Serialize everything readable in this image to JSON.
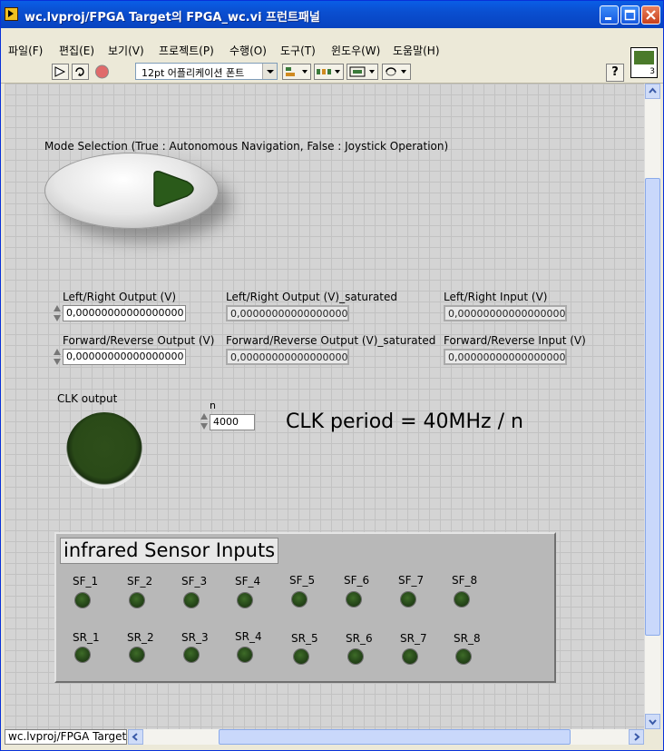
{
  "window": {
    "title": "wc.lvproj/FPGA Target의 FPGA_wc.vi 프런트패널",
    "menu": [
      "파일(F)",
      "편집(E)",
      "보기(V)",
      "프로젝트(P)",
      "수행(O)",
      "도구(T)",
      "윈도우(W)",
      "도움말(H)"
    ],
    "font_select": "12pt 어플리케이션 폰트",
    "help_label": "?",
    "vi_icon_number": "3",
    "status_field": "wc.lvproj/FPGA Target"
  },
  "panel": {
    "mode_label": "Mode Selection (True : Autonomous Navigation, False : Joystick Operation)",
    "mode_value": true,
    "lr_output_label": "Left/Right Output (V)",
    "lr_output_value": "0,00000000000000000",
    "lr_output_sat_label": "Left/Right Output (V)_saturated",
    "lr_output_sat_value": "0,00000000000000000",
    "lr_input_label": "Left/Right Input (V)",
    "lr_input_value": "0,00000000000000000",
    "fr_output_label": "Forward/Reverse Output (V)",
    "fr_output_value": "0,00000000000000000",
    "fr_output_sat_label": "Forward/Reverse Output (V)_saturated",
    "fr_output_sat_value": "0,00000000000000000",
    "fr_input_label": "Forward/Reverse Input (V)",
    "fr_input_value": "0,00000000000000000",
    "clk_label": "CLK output",
    "n_label": "n",
    "n_value": "4000",
    "clk_period_text": "CLK period = 40MHz / n",
    "sensor_group_title": "infrared Sensor Inputs",
    "sensors_front": [
      "SF_1",
      "SF_2",
      "SF_3",
      "SF_4",
      "SF_5",
      "SF_6",
      "SF_7",
      "SF_8"
    ],
    "sensors_rear": [
      "SR_1",
      "SR_2",
      "SR_3",
      "SR_4",
      "SR_5",
      "SR_6",
      "SR_7",
      "SR_8"
    ]
  },
  "colors": {
    "title_bar": "#0a4fd0",
    "led_off": "#2a4a18",
    "panel_bg": "#d4d4d4"
  }
}
